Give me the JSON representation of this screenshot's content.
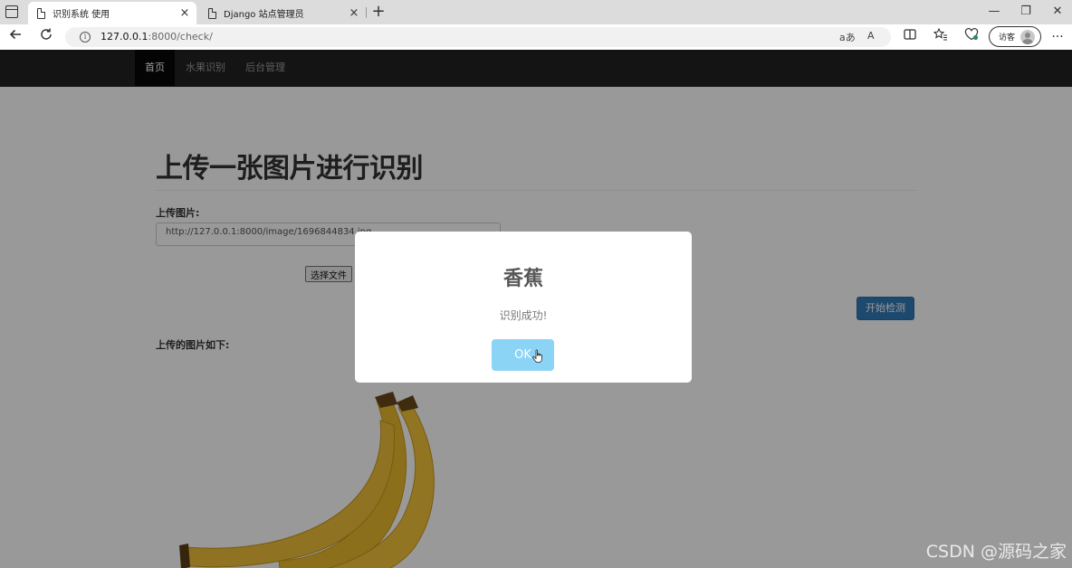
{
  "browser": {
    "tabs": [
      {
        "title": "识别系统 使用",
        "active": true
      },
      {
        "title": "Django 站点管理员",
        "active": false
      }
    ],
    "new_tab": "+",
    "close": "×",
    "window_controls": {
      "minimize": "—",
      "restore": "❐",
      "close": "✕"
    },
    "url_host": "127.0.0.1",
    "url_path": ":8000/check/",
    "omnibox_icons": [
      "read-aloud-icon",
      "immersive-reader-icon"
    ],
    "omnibox_text_a": "aあ",
    "omnibox_text_b": "A",
    "guest_label": "访客",
    "more": "···"
  },
  "navbar": {
    "items": [
      {
        "label": "首页",
        "active": true
      },
      {
        "label": "水果识别",
        "active": false
      },
      {
        "label": "后台管理",
        "active": false
      }
    ]
  },
  "main": {
    "heading": "上传一张图片进行识别",
    "upload_label": "上传图片:",
    "image_url": "http://127.0.0.1:8000/image/1696844834.jpg",
    "file_button": "选择文件",
    "start_button": "开始检测",
    "preview_label": "上传的图片如下:"
  },
  "modal": {
    "title": "香蕉",
    "text": "识别成功!",
    "ok_label": "OK"
  },
  "watermark": "CSDN @源码之家",
  "colors": {
    "navbar_bg": "#222222",
    "primary_button": "#337ab7",
    "ok_button": "#8cd4f5",
    "banana": "#f2c43b"
  }
}
